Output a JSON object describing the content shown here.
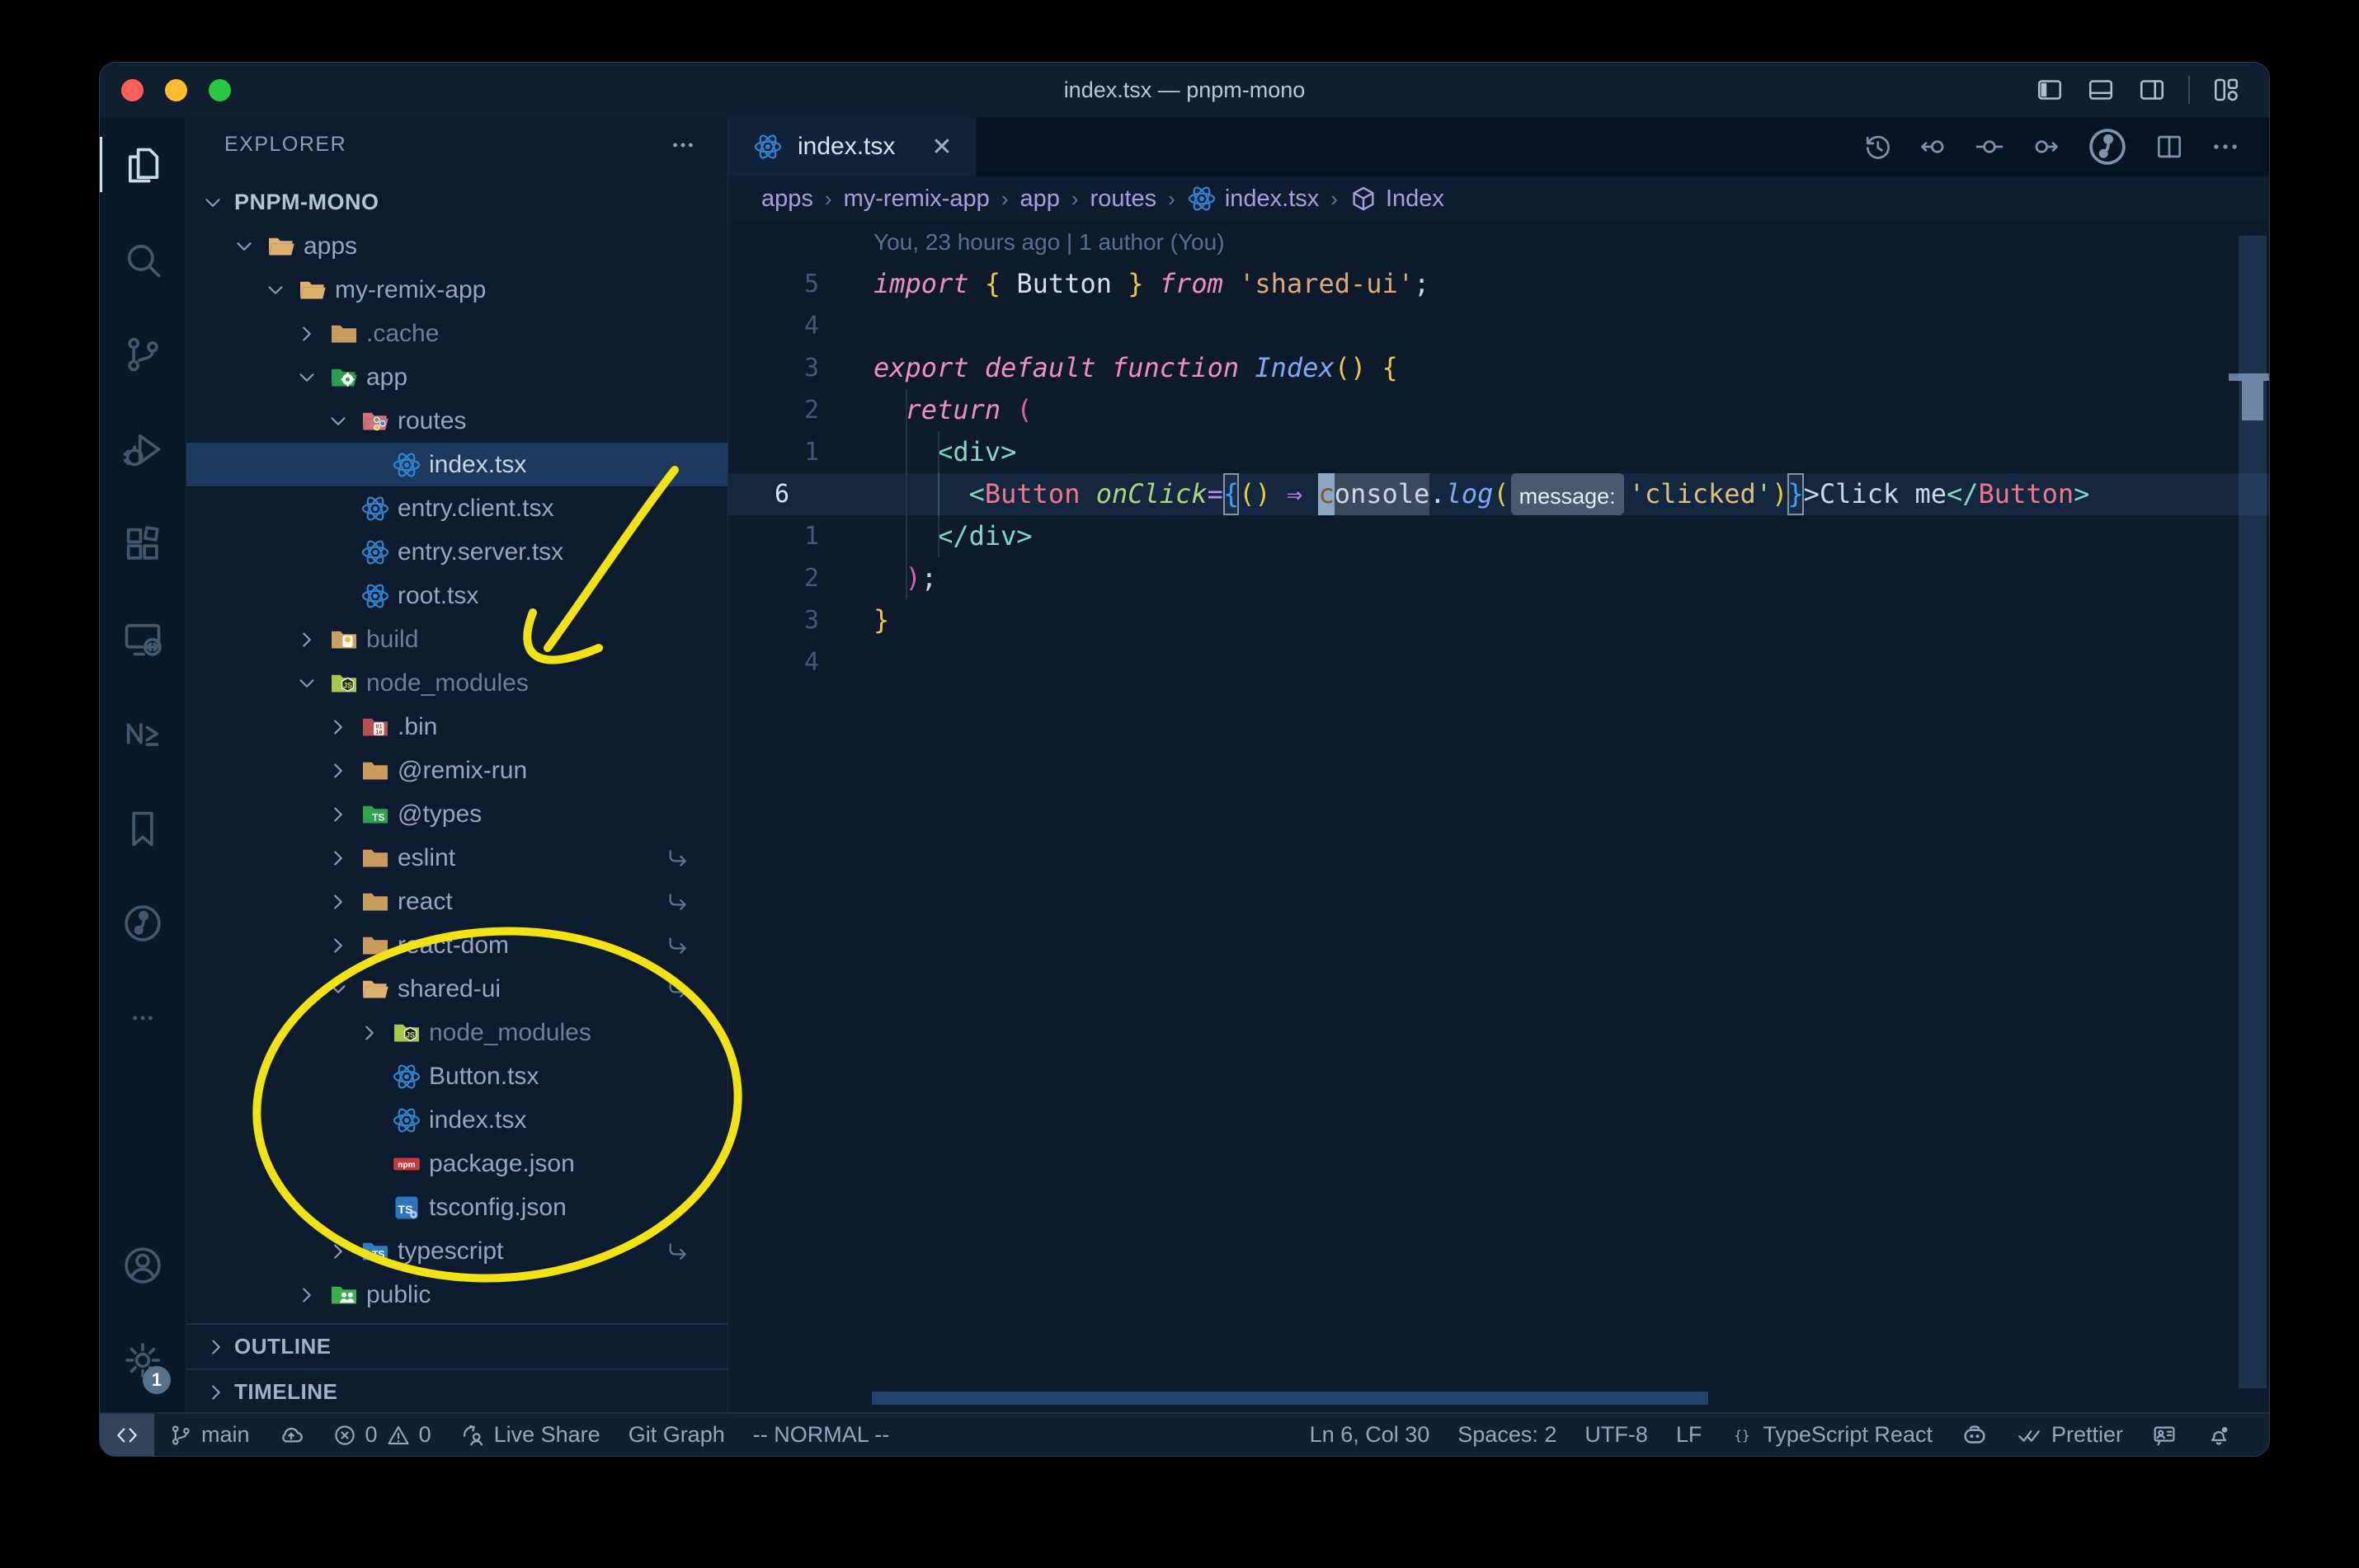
{
  "window": {
    "title": "index.tsx — pnpm-mono",
    "controls": [
      "close",
      "minimize",
      "zoom"
    ]
  },
  "colors": {
    "annotation_yellow": "#f2e113",
    "selection_blue": "#1c3a5e",
    "editor_bg": "#0c1a2c",
    "status_bg": "#0f2031",
    "accent_react_blue": "#2f83cf",
    "traffic": [
      "#ff5f57",
      "#febc2e",
      "#28c840"
    ]
  },
  "titlebar": {
    "layout_icons": [
      "layout-sidebar-left",
      "layout-panel",
      "layout-sidebar-right",
      "layout-customize"
    ]
  },
  "activity_bar": {
    "top": [
      {
        "name": "explorer",
        "icon": "files",
        "active": true
      },
      {
        "name": "search",
        "icon": "search"
      },
      {
        "name": "source-control",
        "icon": "scm"
      },
      {
        "name": "run-debug",
        "icon": "debug"
      },
      {
        "name": "extensions",
        "icon": "ext"
      },
      {
        "name": "remote-explorer",
        "icon": "remote"
      },
      {
        "name": "nx-console",
        "icon": "nx"
      },
      {
        "name": "bookmarks",
        "icon": "bookmark"
      },
      {
        "name": "gitlens",
        "icon": "gitlens"
      },
      {
        "name": "more-views",
        "icon": "ellipsis"
      }
    ],
    "bottom": [
      {
        "name": "accounts",
        "icon": "account"
      },
      {
        "name": "manage",
        "icon": "gear",
        "badge": "1"
      }
    ]
  },
  "sidebar": {
    "header": "EXPLORER",
    "sections": [
      "OUTLINE",
      "TIMELINE"
    ],
    "tree": [
      {
        "label": "PNPM-MONO",
        "depth": 0,
        "chevron": "open",
        "root": true
      },
      {
        "label": "apps",
        "depth": 1,
        "chevron": "open",
        "icon": "folder-open"
      },
      {
        "label": "my-remix-app",
        "depth": 2,
        "chevron": "open",
        "icon": "folder-open"
      },
      {
        "label": ".cache",
        "depth": 3,
        "chevron": "closed",
        "icon": "folder",
        "dim": true
      },
      {
        "label": "app",
        "depth": 3,
        "chevron": "open",
        "icon": "folder-app"
      },
      {
        "label": "routes",
        "depth": 4,
        "chevron": "open",
        "icon": "folder-routes"
      },
      {
        "label": "index.tsx",
        "depth": 5,
        "icon": "react",
        "selected": true
      },
      {
        "label": "entry.client.tsx",
        "depth": 4,
        "icon": "react"
      },
      {
        "label": "entry.server.tsx",
        "depth": 4,
        "icon": "react"
      },
      {
        "label": "root.tsx",
        "depth": 4,
        "icon": "react"
      },
      {
        "label": "build",
        "depth": 3,
        "chevron": "closed",
        "icon": "folder-build",
        "dim": true
      },
      {
        "label": "node_modules",
        "depth": 3,
        "chevron": "open",
        "icon": "folder-node",
        "dim": true
      },
      {
        "label": ".bin",
        "depth": 4,
        "chevron": "closed",
        "icon": "folder-bin"
      },
      {
        "label": "@remix-run",
        "depth": 4,
        "chevron": "closed",
        "icon": "folder"
      },
      {
        "label": "@types",
        "depth": 4,
        "chevron": "closed",
        "icon": "folder-types"
      },
      {
        "label": "eslint",
        "depth": 4,
        "chevron": "closed",
        "icon": "folder",
        "symlink": true
      },
      {
        "label": "react",
        "depth": 4,
        "chevron": "closed",
        "icon": "folder",
        "symlink": true
      },
      {
        "label": "react-dom",
        "depth": 4,
        "chevron": "closed",
        "icon": "folder",
        "symlink": true
      },
      {
        "label": "shared-ui",
        "depth": 4,
        "chevron": "open",
        "icon": "folder-open",
        "symlink": true
      },
      {
        "label": "node_modules",
        "depth": 5,
        "chevron": "closed",
        "icon": "folder-node",
        "dim": true
      },
      {
        "label": "Button.tsx",
        "depth": 5,
        "icon": "react"
      },
      {
        "label": "index.tsx",
        "depth": 5,
        "icon": "react"
      },
      {
        "label": "package.json",
        "depth": 5,
        "icon": "npm"
      },
      {
        "label": "tsconfig.json",
        "depth": 5,
        "icon": "tsconfig"
      },
      {
        "label": "typescript",
        "depth": 4,
        "chevron": "closed",
        "icon": "folder-ts",
        "symlink": true
      },
      {
        "label": "public",
        "depth": 3,
        "chevron": "closed",
        "icon": "folder-public"
      }
    ]
  },
  "tab": {
    "label": "index.tsx",
    "icon": "react",
    "close": "✕"
  },
  "editor_actions": [
    "history",
    "nav-back",
    "nav-dot",
    "nav-forward",
    "gitlens",
    "split-editor",
    "more"
  ],
  "breadcrumbs": [
    {
      "label": "apps"
    },
    {
      "label": "my-remix-app"
    },
    {
      "label": "app"
    },
    {
      "label": "routes"
    },
    {
      "label": "index.tsx",
      "icon": "react"
    },
    {
      "label": "Index",
      "icon": "module"
    }
  ],
  "editor": {
    "blame": "You, 23 hours ago | 1 author (You)",
    "lines": [
      {
        "num": "5",
        "tokens": [
          [
            "import",
            "kw"
          ],
          [
            " ",
            "pun"
          ],
          [
            "{",
            "y"
          ],
          [
            " ",
            "pun"
          ],
          [
            "Button",
            "id"
          ],
          [
            " ",
            "pun"
          ],
          [
            "}",
            "y"
          ],
          [
            " ",
            "pun"
          ],
          [
            "from",
            "kw"
          ],
          [
            " ",
            "pun"
          ],
          [
            "'shared-ui'",
            "str"
          ],
          [
            ";",
            "pun"
          ]
        ]
      },
      {
        "num": "4",
        "tokens": []
      },
      {
        "num": "3",
        "tokens": [
          [
            "export",
            "kw"
          ],
          [
            " ",
            "pun"
          ],
          [
            "default",
            "kw"
          ],
          [
            " ",
            "pun"
          ],
          [
            "function",
            "kw"
          ],
          [
            " ",
            "pun"
          ],
          [
            "Index",
            "fn"
          ],
          [
            "()",
            "y"
          ],
          [
            " ",
            "pun"
          ],
          [
            "{",
            "y"
          ]
        ]
      },
      {
        "num": "2",
        "tokens": [
          [
            "  ",
            "pun"
          ],
          [
            "return",
            "kw"
          ],
          [
            " ",
            "pun"
          ],
          [
            "(",
            "pk"
          ]
        ]
      },
      {
        "num": "1",
        "tokens": [
          [
            "    ",
            "pun"
          ],
          [
            "<",
            "tag"
          ],
          [
            "div",
            "tag"
          ],
          [
            ">",
            "tag"
          ]
        ]
      },
      {
        "num": "6",
        "current": true,
        "tokens": [
          [
            "      ",
            "pun"
          ],
          [
            "<",
            "tag"
          ],
          [
            "Button",
            "cmp"
          ],
          [
            " ",
            "pun"
          ],
          [
            "onClick",
            "attr"
          ],
          [
            "=",
            "op"
          ],
          [
            "{",
            "blx"
          ],
          [
            "()",
            "y"
          ],
          [
            " ",
            "pun"
          ],
          [
            "⇒",
            "op"
          ],
          [
            " ",
            "pun"
          ],
          [
            "c",
            "cur"
          ],
          [
            "onsole",
            "whl"
          ],
          [
            ".",
            "pun"
          ],
          [
            "log",
            "fn"
          ],
          [
            "(",
            "y"
          ],
          [
            "message:",
            "inlay"
          ],
          [
            "'clicked'",
            "str2"
          ],
          [
            ")",
            "y"
          ],
          [
            "}",
            "blx"
          ],
          [
            ">",
            "pun"
          ],
          [
            "Click me",
            "pun"
          ],
          [
            "<",
            "tag"
          ],
          [
            "/",
            "tag"
          ],
          [
            "Button",
            "cmp"
          ],
          [
            ">",
            "tag"
          ]
        ]
      },
      {
        "num": "1",
        "tokens": [
          [
            "    ",
            "pun"
          ],
          [
            "<",
            "tag"
          ],
          [
            "/div",
            "tag"
          ],
          [
            ">",
            "tag"
          ]
        ]
      },
      {
        "num": "2",
        "tokens": [
          [
            "  ",
            "pun"
          ],
          [
            ")",
            "pk"
          ],
          [
            ";",
            "pun"
          ]
        ]
      },
      {
        "num": "3",
        "tokens": [
          [
            "}",
            "y"
          ]
        ]
      },
      {
        "num": "4",
        "tokens": []
      }
    ]
  },
  "status_bar": {
    "left": [
      {
        "name": "remote-indicator",
        "icon": "remote-ind",
        "label": "",
        "remote": true
      },
      {
        "name": "git-branch",
        "icon": "branch",
        "label": "main"
      },
      {
        "name": "sync",
        "icon": "cloud",
        "label": ""
      },
      {
        "name": "problems",
        "icon": "error",
        "label": "0",
        "icon2": "warning",
        "label2": "0"
      },
      {
        "name": "live-share",
        "icon": "share",
        "label": "Live Share"
      },
      {
        "name": "git-graph",
        "label": "Git Graph"
      },
      {
        "name": "vim-mode",
        "label": "-- NORMAL --"
      }
    ],
    "right": [
      {
        "name": "cursor-position",
        "label": "Ln 6, Col 30"
      },
      {
        "name": "indentation",
        "label": "Spaces: 2"
      },
      {
        "name": "encoding",
        "label": "UTF-8"
      },
      {
        "name": "eol",
        "label": "LF"
      },
      {
        "name": "language-mode",
        "icon": "braces",
        "label": "TypeScript React"
      },
      {
        "name": "copilot",
        "icon": "copilot",
        "label": ""
      },
      {
        "name": "formatter",
        "icon": "check2",
        "label": "Prettier"
      },
      {
        "name": "feedback",
        "icon": "feedback",
        "label": ""
      },
      {
        "name": "notifications",
        "icon": "bell",
        "label": ""
      }
    ]
  }
}
